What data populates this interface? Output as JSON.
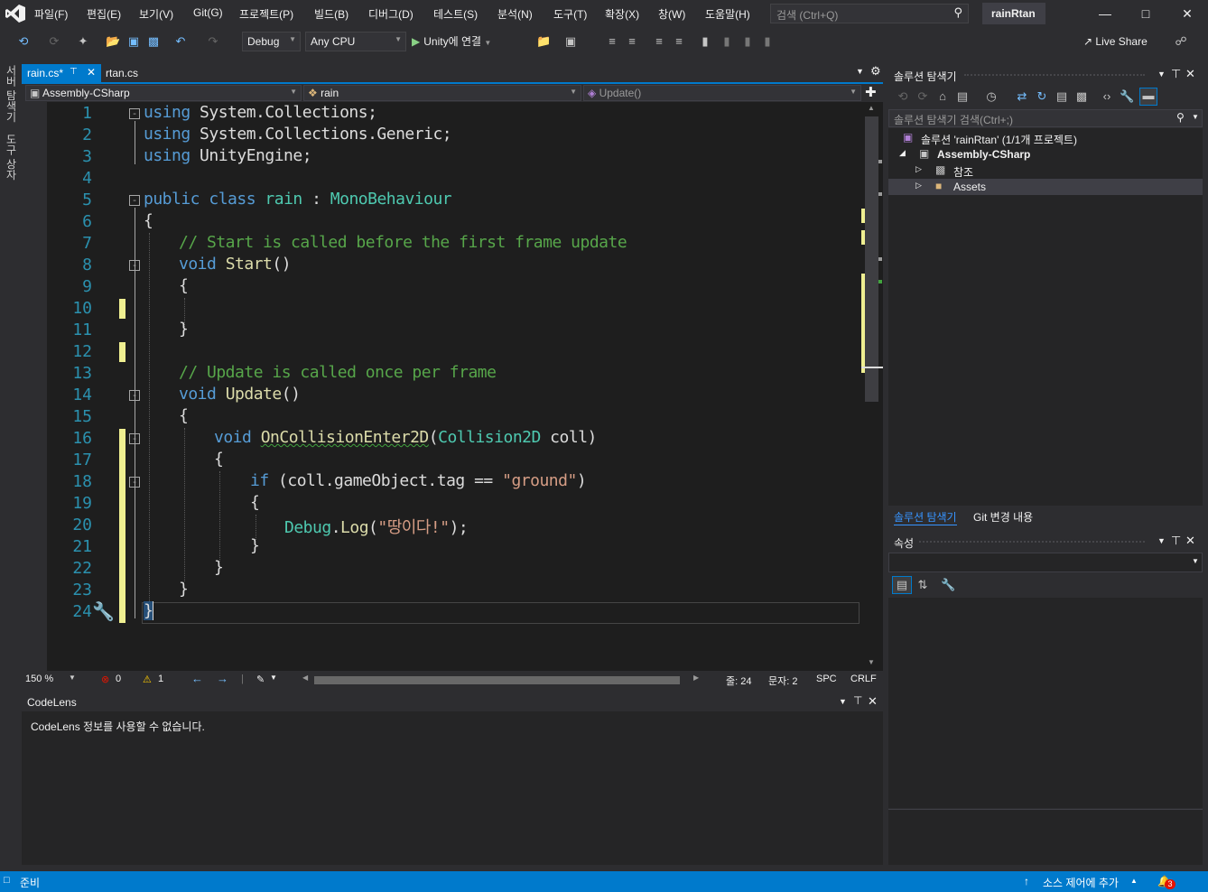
{
  "menu": [
    "파일(F)",
    "편집(E)",
    "보기(V)",
    "Git(G)",
    "프로젝트(P)",
    "빌드(B)",
    "디버그(D)",
    "테스트(S)",
    "분석(N)",
    "도구(T)",
    "확장(X)",
    "창(W)",
    "도움말(H)"
  ],
  "search": {
    "placeholder": "검색 (Ctrl+Q)"
  },
  "solution_title": "rainRtan",
  "toolbar": {
    "config": "Debug",
    "platform": "Any CPU",
    "run_label": "Unity에 연결",
    "live_share": "Live Share"
  },
  "left_tabs": [
    "서버 탐색기",
    "도구 상자"
  ],
  "editor": {
    "tabs": [
      {
        "label": "rain.cs*",
        "active": true
      },
      {
        "label": "rtan.cs",
        "active": false
      }
    ],
    "nav": {
      "project": "Assembly-CSharp",
      "class": "rain",
      "member": "Update()"
    },
    "line_numbers": [
      "1",
      "2",
      "3",
      "4",
      "5",
      "6",
      "7",
      "8",
      "9",
      "10",
      "11",
      "12",
      "13",
      "14",
      "15",
      "16",
      "17",
      "18",
      "19",
      "20",
      "21",
      "22",
      "23",
      "24"
    ],
    "code": {
      "l1_kw": "using",
      "l1_rest": " System.Collections;",
      "l2_kw": "using",
      "l2_rest": " System.Collections.Generic;",
      "l3_kw": "using",
      "l3_rest": " UnityEngine;",
      "l5_kw": "public class",
      "l5_name": "rain",
      "l5_colon": " : ",
      "l5_base": "MonoBehaviour",
      "l6": "{",
      "l7": "// Start is called before the first frame update",
      "l8_kw": "void",
      "l8_fn": "Start",
      "l8_paren": "()",
      "l9": "{",
      "l11": "}",
      "l13": "// Update is called once per frame",
      "l14_kw": "void",
      "l14_fn": "Update",
      "l14_paren": "()",
      "l15": "{",
      "l16_kw": "void",
      "l16_fn": "OnCollisionEnter2D",
      "l16_open": "(",
      "l16_type": "Collision2D",
      "l16_param": " coll)",
      "l17": "{",
      "l18_kw": "if",
      "l18_rest": " (coll.gameObject.tag == ",
      "l18_str": "\"ground\"",
      "l18_close": ")",
      "l19": "{",
      "l20_cls": "Debug",
      "l20_dot": ".",
      "l20_fn": "Log",
      "l20_open": "(",
      "l20_str": "\"땅이다!\"",
      "l20_close": ");",
      "l21": "}",
      "l22": "}",
      "l23": "}",
      "l24": "}"
    },
    "status": {
      "zoom": "150 %",
      "errors": "0",
      "warnings": "1",
      "line": "줄: 24",
      "col": "문자: 2",
      "spc": "SPC",
      "eol": "CRLF"
    }
  },
  "codelens": {
    "title": "CodeLens",
    "message": "CodeLens 정보를 사용할 수 없습니다."
  },
  "solution_explorer": {
    "title": "솔루션 탐색기",
    "search_placeholder": "솔루션 탐색기 검색(Ctrl+;)",
    "tree": {
      "solution": "솔루션 'rainRtan' (1/1개 프로젝트)",
      "project": "Assembly-CSharp",
      "references": "참조",
      "assets": "Assets"
    },
    "tabs": [
      "솔루션 탐색기",
      "Git 변경 내용"
    ]
  },
  "properties": {
    "title": "속성"
  },
  "statusbar": {
    "ready": "준비",
    "source_control": "소스 제어에 추가",
    "notifications": "3"
  },
  "colors": {
    "accent": "#007acc",
    "background": "#1e1e1e",
    "chrome": "#2d2d30"
  }
}
